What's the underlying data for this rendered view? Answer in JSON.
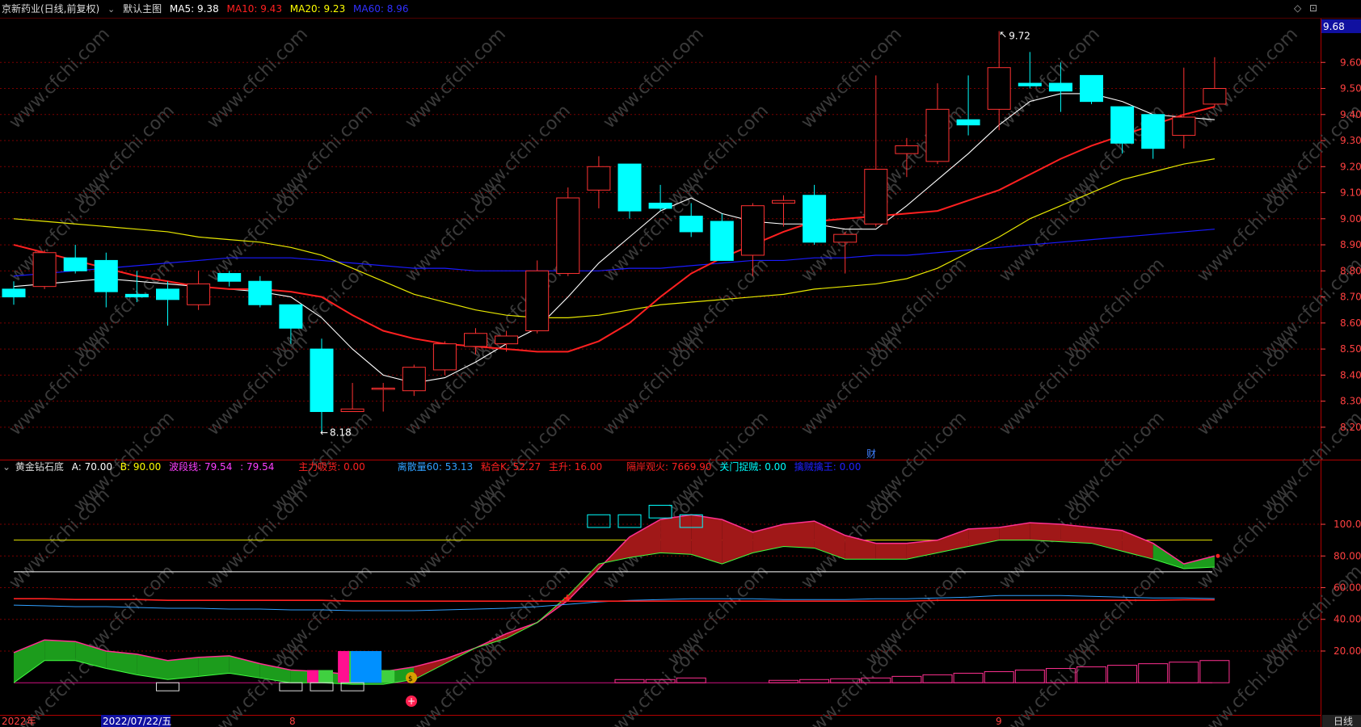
{
  "main_header": {
    "title": "京新药业(日线,前复权)",
    "main_chart_label": "默认主图",
    "ma5_label": "MA5:",
    "ma5_value": "9.38",
    "ma10_label": "MA10:",
    "ma10_value": "9.43",
    "ma20_label": "MA20:",
    "ma20_value": "9.23",
    "ma60_label": "MA60:",
    "ma60_value": "8.96"
  },
  "indicator_header": {
    "name": "黄金钻石底",
    "a_label": "A:",
    "a_value": "70.00",
    "b_label": "B:",
    "b_value": "90.00",
    "wave_label": "波段线:",
    "wave_value": "79.54",
    "blank_label": ":",
    "blank_value": "79.54",
    "zhuli_label": "主力吸货:",
    "zhuli_value": "0.00",
    "lisan_label": "离散量60:",
    "lisan_value": "53.13",
    "nianhe_label": "粘合K:",
    "nianhe_value": "52.27",
    "zhusheng_label": "主升:",
    "zhusheng_value": "16.00",
    "gean_label": "隔岸观火:",
    "gean_value": "7669.90",
    "guanmen_label": "关门捉贼:",
    "guanmen_value": "0.00",
    "qinzei_label": "擒贼擒王:",
    "qinzei_value": "0.00"
  },
  "price_axis": {
    "current_price": "9.68",
    "ticks": [
      "9.60",
      "9.50",
      "9.40",
      "9.30",
      "9.20",
      "9.10",
      "9.00",
      "8.90",
      "8.80",
      "8.70",
      "8.60",
      "8.50",
      "8.40",
      "8.30",
      "8.20"
    ]
  },
  "indicator_axis": {
    "ticks": [
      "100.0",
      "80.00",
      "60.00",
      "40.00",
      "20.00"
    ]
  },
  "annotations": {
    "high_label": "9.72",
    "low_label": "8.18",
    "finance_marker": "财"
  },
  "date_axis": {
    "year_label": "2022年",
    "cursor_date": "2022/07/22/五",
    "month_aug": "8",
    "month_sep": "9",
    "period_button": "日线"
  },
  "watermark": "www.cfchi.com",
  "colors": {
    "up": "#ff3232",
    "down": "#00ffff",
    "ma5": "#ffffff",
    "ma10": "#ff2020",
    "ma20": "#e8e800",
    "ma60": "#1a1aff",
    "grid": "#7a0000",
    "axis_text": "#ff4040"
  },
  "chart_data": {
    "type": "candlestick",
    "price_range": [
      8.14,
      9.74
    ],
    "candles": [
      {
        "o": 8.73,
        "h": 8.76,
        "l": 8.67,
        "c": 8.7
      },
      {
        "o": 8.74,
        "h": 8.88,
        "l": 8.73,
        "c": 8.87
      },
      {
        "o": 8.85,
        "h": 8.9,
        "l": 8.79,
        "c": 8.8
      },
      {
        "o": 8.84,
        "h": 8.87,
        "l": 8.66,
        "c": 8.72
      },
      {
        "o": 8.71,
        "h": 8.8,
        "l": 8.68,
        "c": 8.7
      },
      {
        "o": 8.73,
        "h": 8.76,
        "l": 8.59,
        "c": 8.69
      },
      {
        "o": 8.67,
        "h": 8.8,
        "l": 8.65,
        "c": 8.75
      },
      {
        "o": 8.79,
        "h": 8.8,
        "l": 8.74,
        "c": 8.76
      },
      {
        "o": 8.76,
        "h": 8.78,
        "l": 8.66,
        "c": 8.67
      },
      {
        "o": 8.67,
        "h": 8.67,
        "l": 8.52,
        "c": 8.58
      },
      {
        "o": 8.5,
        "h": 8.54,
        "l": 8.18,
        "c": 8.26
      },
      {
        "o": 8.26,
        "h": 8.37,
        "l": 8.26,
        "c": 8.27
      },
      {
        "o": 8.35,
        "h": 8.37,
        "l": 8.26,
        "c": 8.35
      },
      {
        "o": 8.34,
        "h": 8.44,
        "l": 8.32,
        "c": 8.43
      },
      {
        "o": 8.42,
        "h": 8.53,
        "l": 8.4,
        "c": 8.52
      },
      {
        "o": 8.51,
        "h": 8.58,
        "l": 8.48,
        "c": 8.56
      },
      {
        "o": 8.52,
        "h": 8.57,
        "l": 8.49,
        "c": 8.55
      },
      {
        "o": 8.57,
        "h": 8.84,
        "l": 8.56,
        "c": 8.8
      },
      {
        "o": 8.79,
        "h": 9.12,
        "l": 8.78,
        "c": 9.08
      },
      {
        "o": 9.11,
        "h": 9.24,
        "l": 9.04,
        "c": 9.2
      },
      {
        "o": 9.21,
        "h": 9.21,
        "l": 9.0,
        "c": 9.03
      },
      {
        "o": 9.06,
        "h": 9.13,
        "l": 9.03,
        "c": 9.04
      },
      {
        "o": 9.01,
        "h": 9.06,
        "l": 8.93,
        "c": 8.95
      },
      {
        "o": 8.99,
        "h": 9.02,
        "l": 8.84,
        "c": 8.84
      },
      {
        "o": 8.86,
        "h": 9.06,
        "l": 8.78,
        "c": 9.05
      },
      {
        "o": 9.06,
        "h": 9.09,
        "l": 8.97,
        "c": 9.07
      },
      {
        "o": 9.09,
        "h": 9.13,
        "l": 8.9,
        "c": 8.91
      },
      {
        "o": 8.91,
        "h": 8.95,
        "l": 8.79,
        "c": 8.94
      },
      {
        "o": 8.98,
        "h": 9.55,
        "l": 8.97,
        "c": 9.19
      },
      {
        "o": 9.25,
        "h": 9.31,
        "l": 9.16,
        "c": 9.28
      },
      {
        "o": 9.22,
        "h": 9.52,
        "l": 9.21,
        "c": 9.42
      },
      {
        "o": 9.38,
        "h": 9.55,
        "l": 9.32,
        "c": 9.36
      },
      {
        "o": 9.42,
        "h": 9.72,
        "l": 9.34,
        "c": 9.58
      },
      {
        "o": 9.52,
        "h": 9.64,
        "l": 9.5,
        "c": 9.51
      },
      {
        "o": 9.52,
        "h": 9.6,
        "l": 9.41,
        "c": 9.49
      },
      {
        "o": 9.55,
        "h": 9.55,
        "l": 9.44,
        "c": 9.45
      },
      {
        "o": 9.43,
        "h": 9.43,
        "l": 9.25,
        "c": 9.29
      },
      {
        "o": 9.4,
        "h": 9.4,
        "l": 9.23,
        "c": 9.27
      },
      {
        "o": 9.32,
        "h": 9.58,
        "l": 9.27,
        "c": 9.39
      },
      {
        "o": 9.44,
        "h": 9.62,
        "l": 9.43,
        "c": 9.5
      }
    ],
    "ma5": [
      8.74,
      8.75,
      8.76,
      8.77,
      8.76,
      8.75,
      8.74,
      8.73,
      8.72,
      8.7,
      8.62,
      8.5,
      8.4,
      8.37,
      8.39,
      8.45,
      8.52,
      8.58,
      8.7,
      8.83,
      8.93,
      9.03,
      9.08,
      9.02,
      8.99,
      8.98,
      8.98,
      8.96,
      8.96,
      9.05,
      9.15,
      9.25,
      9.36,
      9.45,
      9.48,
      9.48,
      9.45,
      9.4,
      9.39,
      9.38
    ],
    "ma10": [
      8.9,
      8.87,
      8.84,
      8.81,
      8.78,
      8.76,
      8.74,
      8.73,
      8.73,
      8.72,
      8.7,
      8.63,
      8.57,
      8.54,
      8.52,
      8.51,
      8.5,
      8.49,
      8.49,
      8.53,
      8.6,
      8.7,
      8.79,
      8.85,
      8.9,
      8.95,
      8.99,
      9.0,
      9.01,
      9.02,
      9.03,
      9.07,
      9.11,
      9.17,
      9.23,
      9.28,
      9.32,
      9.36,
      9.4,
      9.43
    ],
    "ma20": [
      9.0,
      8.99,
      8.98,
      8.97,
      8.96,
      8.95,
      8.93,
      8.92,
      8.91,
      8.89,
      8.86,
      8.81,
      8.76,
      8.71,
      8.68,
      8.65,
      8.63,
      8.62,
      8.62,
      8.63,
      8.65,
      8.67,
      8.68,
      8.69,
      8.7,
      8.71,
      8.73,
      8.74,
      8.75,
      8.77,
      8.81,
      8.87,
      8.93,
      9.0,
      9.05,
      9.1,
      9.15,
      9.18,
      9.21,
      9.23
    ],
    "ma60": [
      8.78,
      8.79,
      8.8,
      8.81,
      8.82,
      8.83,
      8.84,
      8.85,
      8.85,
      8.85,
      8.84,
      8.83,
      8.82,
      8.81,
      8.81,
      8.8,
      8.8,
      8.8,
      8.8,
      8.8,
      8.81,
      8.81,
      8.82,
      8.83,
      8.84,
      8.84,
      8.85,
      8.85,
      8.86,
      8.86,
      8.87,
      8.88,
      8.89,
      8.9,
      8.91,
      8.92,
      8.93,
      8.94,
      8.95,
      8.96
    ],
    "indicator": {
      "range": [
        -5,
        125
      ],
      "wave_upper": [
        19,
        27,
        26,
        20,
        18,
        14,
        16,
        17,
        12,
        8,
        7,
        5,
        7,
        10,
        15,
        22,
        31,
        38,
        52,
        72,
        92,
        103,
        106,
        103,
        95,
        100,
        102,
        93,
        88,
        88,
        90,
        97,
        98,
        101,
        100,
        98,
        96,
        88,
        75,
        80
      ],
      "wave_lower": [
        0,
        14,
        14,
        9,
        5,
        2,
        4,
        6,
        3,
        0,
        0,
        -1,
        -1,
        2,
        12,
        22,
        28,
        38,
        55,
        75,
        79,
        82,
        81,
        75,
        82,
        86,
        85,
        78,
        78,
        78,
        82,
        86,
        90,
        90,
        89,
        88,
        83,
        78,
        72,
        73
      ],
      "line_a": 70,
      "line_b": 90,
      "lisan60": [
        49,
        48.5,
        48,
        48,
        47.5,
        47,
        47,
        46.5,
        46.5,
        46,
        46,
        45.5,
        45.5,
        45.5,
        46,
        46.5,
        47,
        48,
        49.5,
        51,
        52,
        52.5,
        53,
        53,
        53,
        52.5,
        52.5,
        52.5,
        53,
        53,
        53.5,
        54,
        55,
        55,
        55,
        54.5,
        54,
        53.5,
        53.5,
        53.1
      ],
      "nianhe": [
        53,
        53,
        52.5,
        52.5,
        52.5,
        52,
        52,
        52,
        52,
        52,
        52,
        51.5,
        51.5,
        51.5,
        51.5,
        51.5,
        51.5,
        51.5,
        51.5,
        51.5,
        51.5,
        51.5,
        51.5,
        51.5,
        51.5,
        51.5,
        51.5,
        51.5,
        51.5,
        51.5,
        52,
        52,
        52,
        52,
        52,
        52,
        52,
        52,
        52.3,
        52.3
      ],
      "zhusheng": [
        0,
        0,
        0,
        0,
        0,
        0,
        0,
        0,
        0,
        0,
        0,
        0,
        0,
        0,
        0,
        0,
        0,
        0,
        0,
        0,
        2,
        2,
        3,
        0,
        0,
        1.5,
        2,
        2.5,
        3,
        4,
        5,
        6,
        7,
        8,
        9,
        10,
        11,
        12,
        13,
        14
      ],
      "bars": [
        {
          "i": 10,
          "v": 8
        },
        {
          "i": 11,
          "v": 20
        },
        {
          "i": 12,
          "v": 8
        }
      ]
    }
  }
}
